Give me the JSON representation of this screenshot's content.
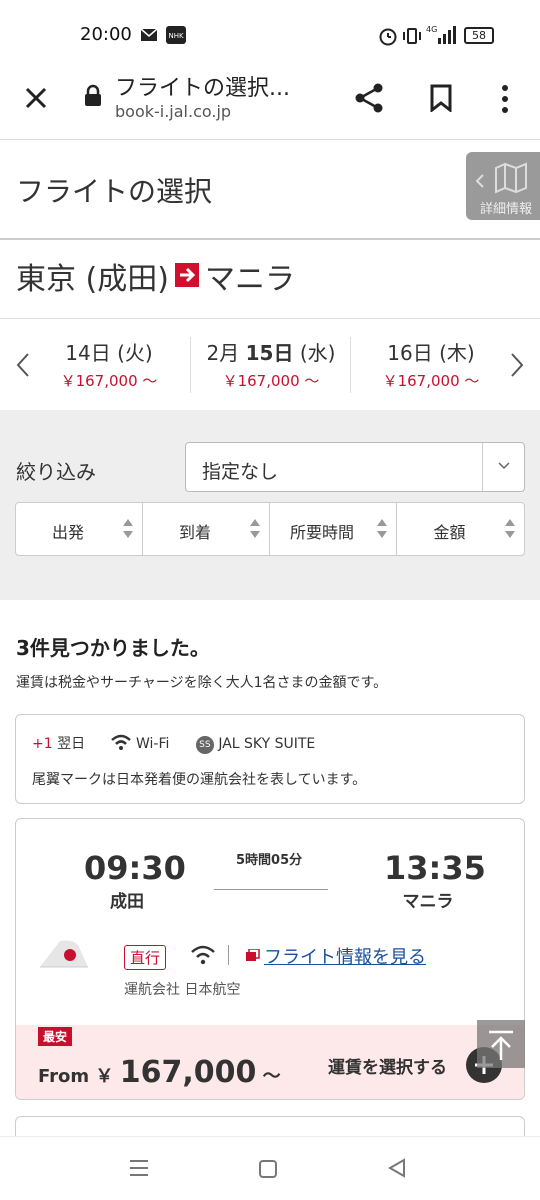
{
  "status_bar": {
    "time": "20:00",
    "battery": "58",
    "network": "4G"
  },
  "browser": {
    "page_title": "フライトの選択...",
    "url": "book-i.jal.co.jp"
  },
  "page": {
    "title": "フライトの選択",
    "detail_button_label": "詳細情報"
  },
  "route": {
    "origin": "東京 (成田)",
    "destination": "マニラ"
  },
  "dates": [
    {
      "label": "14日 (火)",
      "price": "￥167,000 ～",
      "selected": false
    },
    {
      "month": "2月 ",
      "day": "15日",
      "weekday": " (水)",
      "price": "￥167,000 ～",
      "selected": true
    },
    {
      "label": "16日 (木)",
      "price": "￥167,000 ～",
      "selected": false
    }
  ],
  "filter": {
    "label": "絞り込み",
    "value": "指定なし"
  },
  "sort_tabs": [
    "出発",
    "到着",
    "所要時間",
    "金額"
  ],
  "results": {
    "count_text": "3件見つかりました。",
    "fare_note": "運賃は税金やサーチャージを除く大人1名さまの金額です。"
  },
  "legend": {
    "next_day_mark": "+1",
    "next_day_label": "翌日",
    "wifi_label": "Wi-Fi",
    "ss_badge": "SS",
    "suite_label": "JAL SKY SUITE",
    "tail_note": "尾翼マークは日本発着便の運航会社を表しています。"
  },
  "flights": [
    {
      "dep_time": "09:30",
      "dep_airport": "成田",
      "duration": "5時間05分",
      "arr_time": "13:35",
      "arr_airport": "マニラ",
      "direct_label": "直行",
      "info_link": "フライト情報を見る",
      "operator": "運航会社 日本航空",
      "badge": "最安",
      "from_label": "From ￥",
      "price": "167,000",
      "price_suffix": "～",
      "select_label": "運賃を選択する"
    }
  ],
  "colors": {
    "accent": "#c8102e",
    "link": "#1a4f9c",
    "fare_bg": "#fde8ea"
  }
}
